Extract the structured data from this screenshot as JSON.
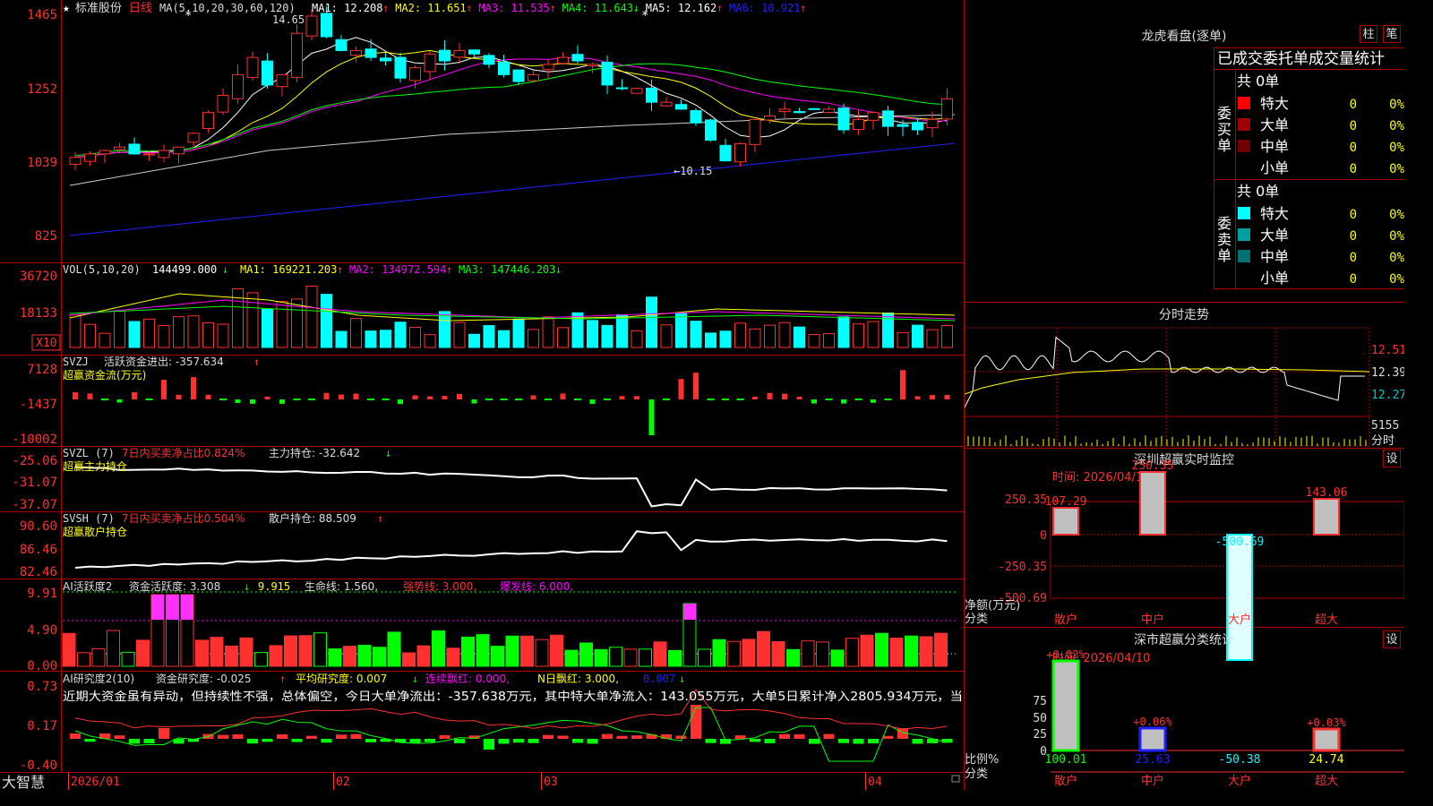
{
  "window": {
    "brand": "大智慧"
  },
  "stock": {
    "name": "标准股份",
    "period": "日线",
    "ma_params": "MA(5,10,20,30,60,120)",
    "ma": [
      {
        "label": "MA1: 12.208",
        "arrow": "↑",
        "color": "#ffffff"
      },
      {
        "label": "MA2: 11.651",
        "arrow": "↑",
        "color": "#ffff00"
      },
      {
        "label": "MA3: 11.535",
        "arrow": "↑",
        "color": "#ff00ff"
      },
      {
        "label": "MA4: 11.643",
        "arrow": "↓",
        "color": "#00ff00"
      },
      {
        "label": "MA5: 12.162",
        "arrow": "↑",
        "color": "#ffffff"
      },
      {
        "label": "MA6: 10.921",
        "arrow": "↑",
        "color": "#2020ff"
      }
    ],
    "high_label": "14.65",
    "low_label": "←10.15",
    "price_axis": [
      "1465",
      "1252",
      "1039",
      "825"
    ]
  },
  "volume": {
    "title": "VOL(5,10,20)",
    "value": "144499.000",
    "value_arrow": "↓",
    "ma": [
      {
        "label": "MA1: 169221.203",
        "arrow": "↑",
        "color": "#ffff00"
      },
      {
        "label": "MA2: 134972.594",
        "arrow": "↑",
        "color": "#ff00ff"
      },
      {
        "label": "MA3: 147446.203",
        "arrow": "↓",
        "color": "#00ff00"
      }
    ],
    "axis": [
      "36720",
      "18133"
    ],
    "unit": "X10"
  },
  "svzj": {
    "title": "SVZJ",
    "label": "活跃资金进出: -357.634",
    "arrow": "↑",
    "subtitle": "超赢资金流(万元)",
    "axis": [
      "7128",
      "-1437",
      "-10002"
    ]
  },
  "svzl": {
    "title": "SVZL (7)",
    "ratio": "7日内买卖净占比0.824%",
    "label": "主力持仓: -32.642",
    "arrow": "↓",
    "subtitle": "超赢主力持仓",
    "axis": [
      "-25.06",
      "-31.07",
      "-37.07"
    ]
  },
  "svsh": {
    "title": "SVSH (7)",
    "ratio": "7日内买卖净占比0.504%",
    "label": "散户持仓: 88.509",
    "arrow": "↑",
    "subtitle": "超赢散户持仓",
    "axis": [
      "90.60",
      "86.46",
      "82.46"
    ]
  },
  "ai_active": {
    "title": "AI活跃度2",
    "label": "资金活跃度: 3.308",
    "arrow": "↓",
    "v2": "9.915",
    "life": "生命线: 1.560,",
    "strong": "强势线: 3.000,",
    "burst": "爆发线: 6.000,",
    "axis": [
      "9.91",
      "4.90",
      "0.00"
    ]
  },
  "ai_research": {
    "title": "AI研究度2(10)",
    "label": "资金研究度: -0.025",
    "arrow": "↑",
    "avg": "平均研究度: 0.007",
    "avg_arrow": "↓",
    "red": "连续飘红: 0.000,",
    "nred": "N日飘红: 3.000,",
    "last": "0.007",
    "last_arrow": "↓",
    "comment": "近期大资金虽有异动，但持续性不强，总体偏空，今日大单净流出：-357.638万元，其中特大单净流入：143.055万元，大单5日累计净入2805.934万元，当",
    "axis": [
      "0.73",
      "0.17",
      "-0.40"
    ]
  },
  "time_axis": [
    "2026/01",
    "02",
    "03",
    "04"
  ],
  "lhb": {
    "title": "龙虎看盘(逐单)",
    "btn1": "柱",
    "btn2": "笔",
    "header": "已成交委托单成交量统计",
    "buy_label": [
      "委",
      "买",
      "单"
    ],
    "sell_label": [
      "委",
      "卖",
      "单"
    ],
    "buy_total": "共 0单",
    "sell_total": "共 0单",
    "buy_rows": [
      {
        "name": "特大",
        "num": "0",
        "pct": "0%",
        "color": "#ff0000"
      },
      {
        "name": "大单",
        "num": "0",
        "pct": "0%",
        "color": "#a00000"
      },
      {
        "name": "中单",
        "num": "0",
        "pct": "0%",
        "color": "#700000"
      },
      {
        "name": "小单",
        "num": "0",
        "pct": "0%",
        "color": ""
      }
    ],
    "sell_rows": [
      {
        "name": "特大",
        "num": "0",
        "pct": "0%",
        "color": "#00ffff"
      },
      {
        "name": "大单",
        "num": "0",
        "pct": "0%",
        "color": "#00a0a0"
      },
      {
        "name": "中单",
        "num": "0",
        "pct": "0%",
        "color": "#007070"
      },
      {
        "name": "小单",
        "num": "0",
        "pct": "0%",
        "color": ""
      }
    ]
  },
  "fenshi": {
    "title": "分时走势",
    "axis": [
      "12.51",
      "12.39",
      "12.27"
    ],
    "vol": "5155",
    "unit": "分时"
  },
  "sz_monitor": {
    "title": "深圳超赢实时监控",
    "btn": "设",
    "time": "时间: 2026/04/10",
    "axis": [
      "250.35",
      "0",
      "-250.35",
      "-500.69"
    ],
    "ylabel1": "净额(万元)",
    "ylabel2": "分类",
    "cats": [
      "散户",
      "中户",
      "大户",
      "超大"
    ],
    "values": [
      107.29,
      250.35,
      -500.69,
      143.06
    ],
    "value_labels": [
      "107.29",
      "250.35",
      "-500.69",
      "143.06"
    ]
  },
  "sz_class": {
    "title": "深市超赢分类统计",
    "btn": "设",
    "time": "时间: 2026/04/10",
    "axis": [
      "75",
      "50",
      "25",
      "0"
    ],
    "ylabel1": "比例%",
    "ylabel2": "分类",
    "cats": [
      "散户",
      "中户",
      "大户",
      "超大"
    ],
    "top_labels": [
      "+0.02%",
      "+0.06%",
      "",
      "+0.03%"
    ],
    "bottom_labels": [
      "100.01",
      "25.63",
      "-50.38",
      "24.74"
    ],
    "values": [
      100,
      25,
      0,
      24
    ]
  }
}
